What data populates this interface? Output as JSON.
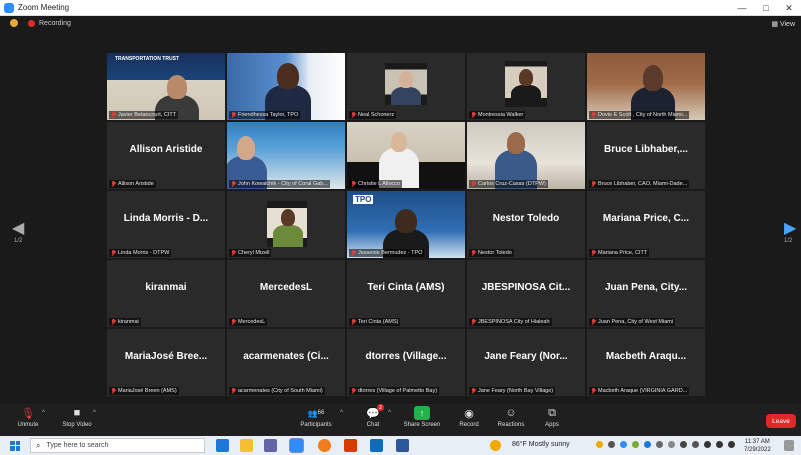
{
  "window": {
    "title": "Zoom Meeting",
    "minimize": "—",
    "maximize": "□",
    "close": "✕"
  },
  "topbar": {
    "recording_label": "Recording",
    "view_label": "View"
  },
  "pager": {
    "left": "1/2",
    "right": "1/2",
    "left_arrow": "◀",
    "right_arrow": "▶"
  },
  "tiles": [
    {
      "big": "",
      "label": "Javier Betancourt, CITT"
    },
    {
      "big": "",
      "label": "Friendhessa Taylor, TPO"
    },
    {
      "big": "",
      "label": "Neal Schonerz"
    },
    {
      "big": "",
      "label": "Montressia Walker"
    },
    {
      "big": "",
      "label": "Dovie E Scott , City of North Miami..."
    },
    {
      "big": "Allison Aristide",
      "label": "Allison Aristide"
    },
    {
      "big": "",
      "label": "John Kowalchik - City of Coral Gab..."
    },
    {
      "big": "",
      "label": "Christie L Allocco"
    },
    {
      "big": "",
      "label": "Carlos Cruz-Casas (DTPW)"
    },
    {
      "big": "Bruce Libhaber,...",
      "label": "Bruce Libhaber, CAO, Miami-Dade..."
    },
    {
      "big": "Linda Morris - D...",
      "label": "Linda Morris - DTPW"
    },
    {
      "big": "",
      "label": "Cheryl Mizell"
    },
    {
      "big": "",
      "label": "Jessenie Bermudez - TPO",
      "banner": "TPO"
    },
    {
      "big": "Nestor Toledo",
      "label": "Nestor Toledo"
    },
    {
      "big": "Mariana Price, C...",
      "label": "Mariana Price, CITT"
    },
    {
      "big": "kiranmai",
      "label": "kiranmai"
    },
    {
      "big": "MercedesL",
      "label": "MercedesL"
    },
    {
      "big": "Teri Cinta (AMS)",
      "label": "Teri Cinta (AMS)"
    },
    {
      "big": "JBESPINOSA Cit...",
      "label": "JBESPINOSA City of Hialeah"
    },
    {
      "big": "Juan Pena, City...",
      "label": "Juan Pena, City of West Miami"
    },
    {
      "big": "MariaJosé Bree...",
      "label": "MariaJosé Breen (AMS)"
    },
    {
      "big": "acarmenates (Ci...",
      "label": "acarmenates (City of South Miami)"
    },
    {
      "big": "dtorres (Village...",
      "label": "dtorres (Village of Palmetto Bay)"
    },
    {
      "big": "Jane Feary (Nor...",
      "label": "Jane Feary (North Bay Village)"
    },
    {
      "big": "Macbeth Araqu...",
      "label": "Macbeth Araque (VIRGINIA GARD..."
    }
  ],
  "first_tile_banner": "TRANSPORTATION TRUST",
  "toolbar": {
    "unmute": "Unmute",
    "stop_video": "Stop Video",
    "participants": "Participants",
    "participants_count": "66",
    "chat": "Chat",
    "chat_badge": "2",
    "share_screen": "Share Screen",
    "record": "Record",
    "reactions": "Reactions",
    "apps": "Apps",
    "leave": "Leave"
  },
  "taskbar": {
    "search_placeholder": "Type here to search",
    "weather": "86°F  Mostly sunny",
    "time": "11:37 AM",
    "date": "7/29/2022"
  },
  "colors": {
    "accent_green": "#22b14c",
    "leave_red": "#e02828",
    "active_speaker": "#c8e05a",
    "muted_red": "#e23b3b"
  }
}
